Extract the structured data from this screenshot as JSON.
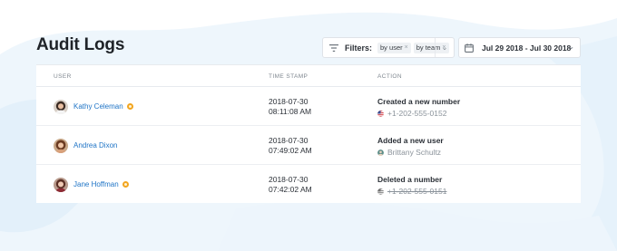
{
  "page": {
    "title": "Audit Logs"
  },
  "filters": {
    "label": "Filters:",
    "chips": [
      "by user",
      "by team"
    ],
    "chip_remove_glyph": "×",
    "dropdown_glyph": "⌄"
  },
  "date_range": {
    "value": "Jul 29 2018 - Jul 30 2018",
    "dropdown_glyph": "⌄"
  },
  "table": {
    "columns": [
      "USER",
      "TIME STAMP",
      "ACTION"
    ],
    "rows": [
      {
        "user": "Kathy Celeman",
        "badge": true,
        "date": "2018-07-30",
        "time": "08:11:08 AM",
        "action": "Created a new number",
        "detail": "+1-202-555-0152",
        "detail_icon": "us-flag-icon",
        "detail_strikethrough": false
      },
      {
        "user": "Andrea Dixon",
        "badge": false,
        "date": "2018-07-30",
        "time": "07:49:02 AM",
        "action": "Added a new user",
        "detail": "Brittany Schultz",
        "detail_icon": "user-avatar-icon",
        "detail_strikethrough": false
      },
      {
        "user": "Jane Hoffman",
        "badge": true,
        "date": "2018-07-30",
        "time": "07:42:02 AM",
        "action": "Deleted a number",
        "detail": "+1-202-555-0151",
        "detail_icon": "us-flag-icon",
        "detail_strikethrough": true
      }
    ]
  },
  "colors": {
    "accent_link": "#1f74c6",
    "badge": "#f2a51f",
    "background_swash": "#e9f3fb"
  }
}
